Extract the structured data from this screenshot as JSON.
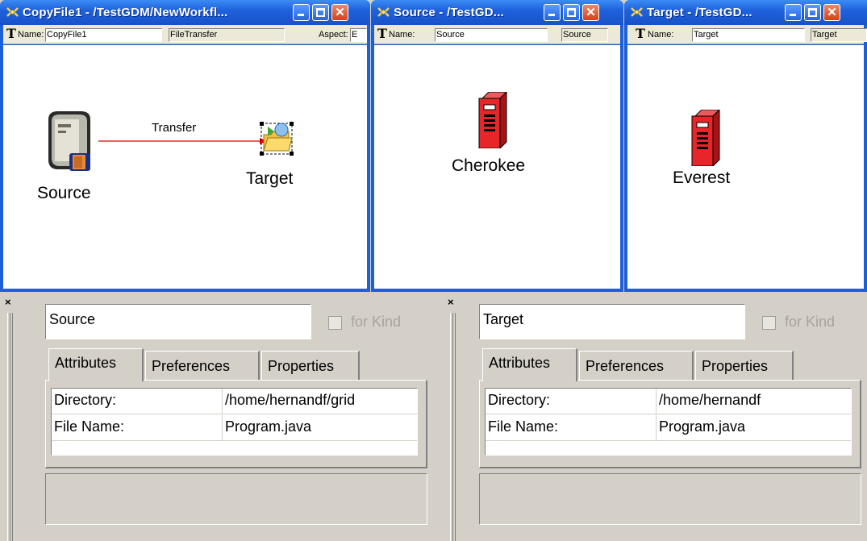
{
  "windows": [
    {
      "title": "CopyFile1 - /TestGDM/NewWorkfl...",
      "name_label": "Name:",
      "name_value": "CopyFile1",
      "kind_value": "FileTransfer",
      "aspect_label": "Aspect:",
      "aspect_value": "E",
      "diagram": {
        "source_label": "Source",
        "target_label": "Target",
        "connection_label": "Transfer",
        "connection_color": "#e00000"
      }
    },
    {
      "title": "Source - /TestGD...",
      "name_label": "Name:",
      "name_value": "Source",
      "kind_value": "Source",
      "diagram": {
        "host_label": "Cherokee"
      }
    },
    {
      "title": "Target - /TestGD...",
      "name_label": "Name:",
      "name_value": "Target",
      "kind_value": "Target",
      "diagram": {
        "host_label": "Everest"
      }
    }
  ],
  "panels": [
    {
      "close_glyph": "×",
      "name_value": "Source",
      "for_kind_label": "for Kind",
      "tabs": [
        "Attributes",
        "Preferences",
        "Properties"
      ],
      "active_tab": "Attributes",
      "attributes": [
        {
          "key": "Directory:",
          "value": "/home/hernandf/grid"
        },
        {
          "key": "File Name:",
          "value": "Program.java"
        }
      ]
    },
    {
      "close_glyph": "×",
      "name_value": "Target",
      "for_kind_label": "for Kind",
      "tabs": [
        "Attributes",
        "Preferences",
        "Properties"
      ],
      "active_tab": "Attributes",
      "attributes": [
        {
          "key": "Directory:",
          "value": "/home/hernandf"
        },
        {
          "key": "File Name:",
          "value": "Program.java"
        }
      ]
    }
  ],
  "colors": {
    "titlebar_blue": "#1f62dc",
    "window_frame": "#1d5fd6",
    "server_red": "#e8262a",
    "close_button": "#d44217",
    "panel_grey": "#d4d0c8"
  },
  "icons": {
    "app_icon": "gme-app-icon",
    "name_icon": "text-t-icon",
    "source_node": "source-server-icon",
    "target_node": "target-folder-icon",
    "host_node": "red-server-icon"
  }
}
